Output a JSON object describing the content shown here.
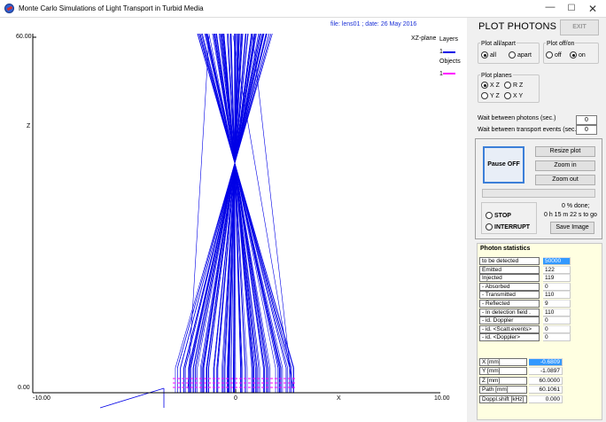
{
  "window": {
    "title": "Monte Carlo Simulations of Light Transport in Turbid Media",
    "minimize": "—",
    "maximize": "☐",
    "close": "✕"
  },
  "plot": {
    "file_info": "file: lens01 ; date: 26 May 2016",
    "plane_label": "XZ-plane",
    "legend": {
      "layers_title": "Layers",
      "layers_index": "1",
      "layers_color": "#0000e6",
      "objects_title": "Objects",
      "objects_index": "1",
      "objects_color": "#ff00ff"
    },
    "y_axis_title": "Z",
    "x_axis_title": "X",
    "y_ticks": [
      "60.00",
      "0.00"
    ],
    "x_ticks": [
      "-10.00",
      "0",
      "10.00"
    ],
    "ray_color": "#0000e6",
    "lens_color": "#ff00ff"
  },
  "panel": {
    "title": "PLOT PHOTONS",
    "exit_label": "EXIT",
    "plot_all_apart": {
      "label": "Plot all/apart",
      "options": [
        "all",
        "apart"
      ],
      "selected": "all"
    },
    "plot_off_on": {
      "label": "Plot off/on",
      "options": [
        "off",
        "on"
      ],
      "selected": "on"
    },
    "plot_planes": {
      "label": "Plot planes",
      "options": [
        "X Z",
        "R Z",
        "Y Z",
        "X Y"
      ],
      "selected": "X Z"
    },
    "wait_photons_label": "Wait between photons (sec.)",
    "wait_photons_value": "0",
    "wait_events_label": "Wait between transport events (sec.)",
    "wait_events_value": "0",
    "pause_label": "Pause OFF",
    "resize_label": "Resize plot",
    "zoom_in_label": "Zoom in",
    "zoom_out_label": "Zoom out",
    "progress_percent": 0,
    "done_text": "0 % done;",
    "time_to_go": "0 h 15 m 22 s to go",
    "stop_label": "STOP",
    "interrupt_label": "INTERRUPT",
    "save_label": "Save Image"
  },
  "stats": {
    "title": "Photon statistics",
    "rows": [
      {
        "label": "to be detected",
        "value": "50000",
        "selected": true
      },
      {
        "label": "Emitted",
        "value": "122"
      },
      {
        "label": "Injected",
        "value": "119"
      },
      {
        "label": " - Absorbed",
        "value": "0"
      },
      {
        "label": " - Transmitted",
        "value": "110"
      },
      {
        "label": " - Reflected",
        "value": "9"
      },
      {
        "label": " - In detection field  .",
        "value": "110"
      },
      {
        "label": " - id. Doppler",
        "value": "0"
      },
      {
        "label": " - id.  <Scatt.events>",
        "value": "0"
      },
      {
        "label": " - id.  <Doppler>",
        "value": "0"
      }
    ],
    "coords": [
      {
        "label": "X   [mm]",
        "value": "-0.6809",
        "selected": true
      },
      {
        "label": "Y   [mm]",
        "value": "-1.0897"
      },
      {
        "label": "Z   [mm]",
        "value": "60.0000"
      },
      {
        "label": "Path [mm]",
        "value": "60.1061"
      },
      {
        "label": "Doppl.shift [kHz]",
        "value": "0.000"
      }
    ]
  }
}
